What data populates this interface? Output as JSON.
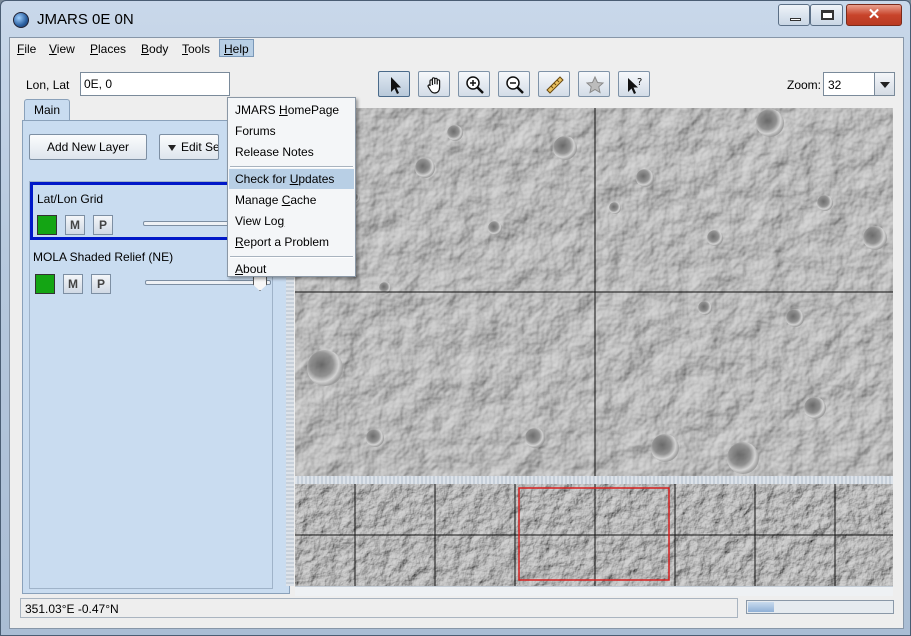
{
  "window": {
    "title": "JMARS 0E 0N"
  },
  "menubar": [
    {
      "label": "File",
      "underline": "F",
      "rest": "ile"
    },
    {
      "label": "View",
      "underline": "V",
      "rest": "iew"
    },
    {
      "label": "Places",
      "underline": "P",
      "rest": "laces"
    },
    {
      "label": "Body",
      "underline": "B",
      "rest": "ody"
    },
    {
      "label": "Tools",
      "underline": "T",
      "rest": "ools"
    },
    {
      "label": "Help",
      "underline": "H",
      "rest": "elp"
    }
  ],
  "lonlat": {
    "label": "Lon, Lat",
    "value": "0E, 0"
  },
  "toolbar": {
    "tools": [
      "select-arrow-icon",
      "pan-hand-icon",
      "zoom-in-icon",
      "zoom-out-icon",
      "ruler-icon",
      "investigate-icon",
      "pointer-help-icon"
    ],
    "selected_tool": "select-arrow-icon",
    "zoom_label": "Zoom:",
    "zoom_value": "32"
  },
  "left_panel": {
    "tab": "Main",
    "add_layer_label": "Add New Layer",
    "edit_label": "Edit Se",
    "layers": [
      {
        "name": "Lat/Lon Grid",
        "m": "M",
        "p": "P",
        "selected": true,
        "color": "#14a514"
      },
      {
        "name": "MOLA Shaded Relief (NE)",
        "m": "M",
        "p": "P",
        "selected": false,
        "color": "#14a514"
      }
    ]
  },
  "help_menu": {
    "items": [
      {
        "pre": "JMARS ",
        "u": "H",
        "post": "omePage",
        "hover": false
      },
      {
        "pre": "Forums",
        "u": "",
        "post": "",
        "hover": false
      },
      {
        "pre": "Release Notes",
        "u": "",
        "post": "",
        "hover": false
      },
      {
        "sep": true
      },
      {
        "pre": "Check for ",
        "u": "U",
        "post": "pdates",
        "hover": true
      },
      {
        "pre": "Manage ",
        "u": "C",
        "post": "ache",
        "hover": false
      },
      {
        "pre": "View Lo",
        "u": "g",
        "post": "",
        "hover": false
      },
      {
        "pre": "",
        "u": "R",
        "post": "eport a Problem",
        "hover": false
      },
      {
        "sep": true
      },
      {
        "pre": "",
        "u": "A",
        "post": "bout",
        "hover": false
      }
    ]
  },
  "status": {
    "coords": "351.03°E  -0.47°N",
    "progress": 0.18
  },
  "colors": {
    "selected_border": "#0018c8",
    "panel_bg": "#c9dcf0",
    "overview_box": "#d62020"
  }
}
